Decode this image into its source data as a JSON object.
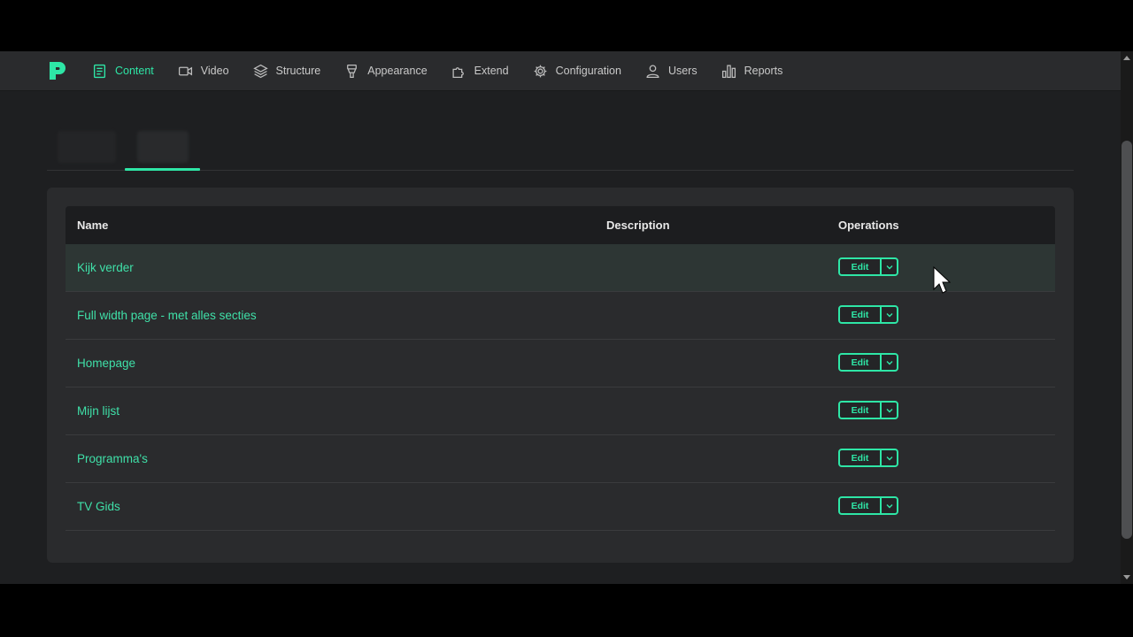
{
  "colors": {
    "accent": "#2ee6a6",
    "background": "#1e1f21",
    "card": "#2a2b2d"
  },
  "nav": {
    "items": [
      {
        "label": "Content",
        "icon": "document-icon",
        "active": true
      },
      {
        "label": "Video",
        "icon": "video-camera-icon"
      },
      {
        "label": "Structure",
        "icon": "layers-icon"
      },
      {
        "label": "Appearance",
        "icon": "paintbrush-icon"
      },
      {
        "label": "Extend",
        "icon": "puzzle-icon"
      },
      {
        "label": "Configuration",
        "icon": "gear-icon"
      },
      {
        "label": "Users",
        "icon": "user-icon"
      },
      {
        "label": "Reports",
        "icon": "bar-chart-icon"
      }
    ]
  },
  "table": {
    "headers": {
      "name": "Name",
      "description": "Description",
      "operations": "Operations"
    },
    "rows": [
      {
        "name": "Kijk verder",
        "description": "",
        "edit": "Edit"
      },
      {
        "name": "Full width page - met alles secties",
        "description": "",
        "edit": "Edit"
      },
      {
        "name": "Homepage",
        "description": "",
        "edit": "Edit"
      },
      {
        "name": "Mijn lijst",
        "description": "",
        "edit": "Edit"
      },
      {
        "name": "Programma's",
        "description": "",
        "edit": "Edit"
      },
      {
        "name": "TV Gids",
        "description": "",
        "edit": "Edit"
      }
    ]
  }
}
